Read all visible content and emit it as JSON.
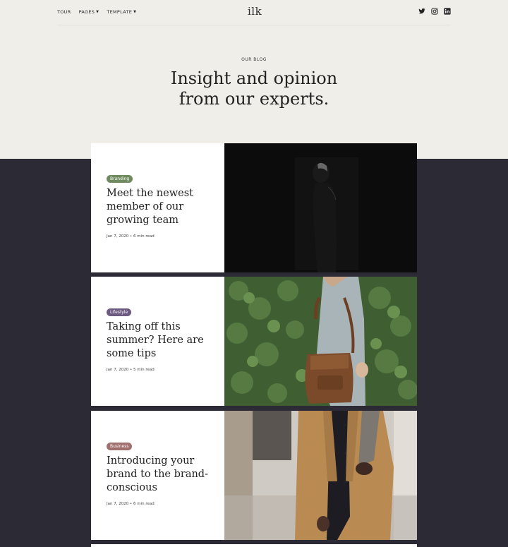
{
  "nav": {
    "items": [
      {
        "label": "TOUR",
        "has_dropdown": false
      },
      {
        "label": "PAGES",
        "has_dropdown": true
      },
      {
        "label": "TEMPLATE",
        "has_dropdown": true
      }
    ],
    "logo": "ilk",
    "social": [
      "twitter-icon",
      "instagram-icon",
      "linkedin-icon"
    ]
  },
  "hero": {
    "eyebrow": "OUR BLOG",
    "title_line1": "Insight and opinion",
    "title_line2": "from our experts."
  },
  "posts": [
    {
      "category": "Branding",
      "category_color": "#6f8a5e",
      "title": "Meet the newest member of our growing team",
      "meta": "Jan 7, 2020 • 6 min read",
      "image": "silhouette-portrait"
    },
    {
      "category": "Lifestyle",
      "category_color": "#6d5a80",
      "title": "Taking off this summer? Here are some tips",
      "meta": "Jan 7, 2020 • 5 min read",
      "image": "woman-with-leather-backpack"
    },
    {
      "category": "Business",
      "category_color": "#a0706e",
      "title": "Introducing your brand to the brand-conscious",
      "meta": "Jan 7, 2020 • 6 min read",
      "image": "person-in-camel-coat-with-laptop"
    }
  ],
  "colors": {
    "top_background": "#efeee9",
    "dark_background": "#2b2a35",
    "card_background": "#ffffff"
  }
}
